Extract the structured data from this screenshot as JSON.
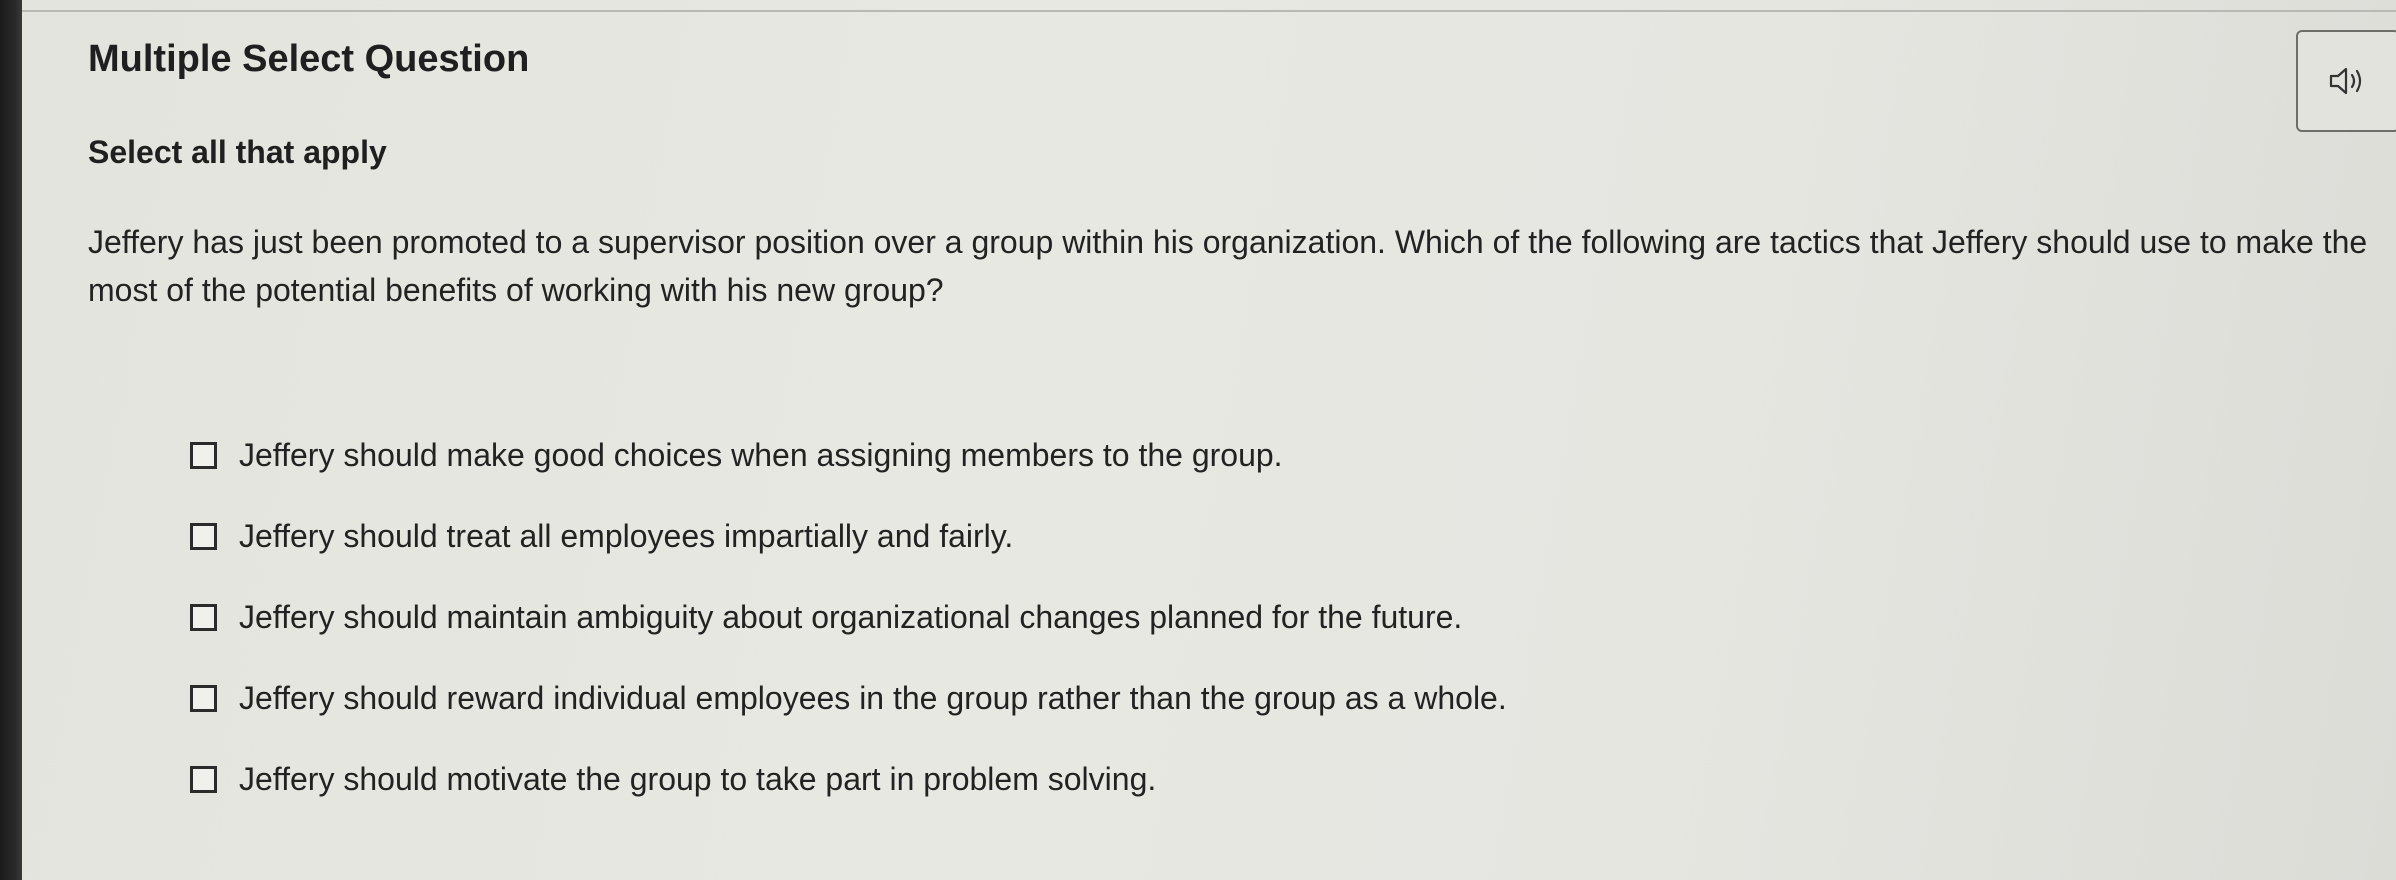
{
  "question": {
    "type_label": "Multiple Select Question",
    "instruction": "Select all that apply",
    "prompt": "Jeffery has just been promoted to a supervisor position over a group within his organization. Which of the following are tactics that Jeffery should use to make the most of the potential benefits of working with his new group?",
    "audio_icon": "speaker-icon"
  },
  "options": [
    {
      "label": "Jeffery should make good choices when assigning members to the group.",
      "checked": false
    },
    {
      "label": "Jeffery should treat all employees impartially and fairly.",
      "checked": false
    },
    {
      "label": "Jeffery should maintain ambiguity about organizational changes planned for the future.",
      "checked": false
    },
    {
      "label": "Jeffery should reward individual employees in the group rather than the group as a whole.",
      "checked": false
    },
    {
      "label": "Jeffery should motivate the group to take part in problem solving.",
      "checked": false
    }
  ]
}
